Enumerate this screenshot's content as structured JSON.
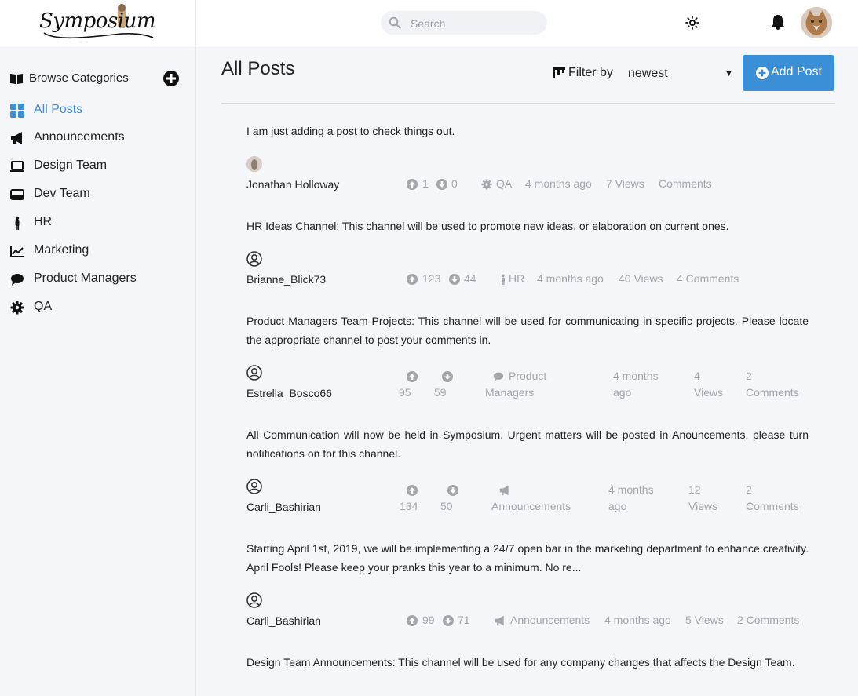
{
  "app": {
    "logo_text": "Symposium"
  },
  "search": {
    "placeholder": "Search"
  },
  "sidebar": {
    "browse_label": "Browse Categories",
    "items": [
      {
        "label": "All Posts",
        "icon": "grid-icon",
        "active": true
      },
      {
        "label": "Announcements",
        "icon": "megaphone-icon"
      },
      {
        "label": "Design Team",
        "icon": "laptop-icon"
      },
      {
        "label": "Dev Team",
        "icon": "hard-drive-icon"
      },
      {
        "label": "HR",
        "icon": "person-icon"
      },
      {
        "label": "Marketing",
        "icon": "line-chart-icon"
      },
      {
        "label": "Product Managers",
        "icon": "comment-icon"
      },
      {
        "label": "QA",
        "icon": "gear-icon"
      }
    ]
  },
  "main": {
    "title": "All Posts",
    "filter_label": "Filter by",
    "filter_value": "newest",
    "add_post_label": "Add Post"
  },
  "colors": {
    "accent": "#3b8fd6",
    "meta_text": "#a3a6ab",
    "background": "#f5f6fa"
  },
  "posts": [
    {
      "text": "I am just adding a post to check things out.",
      "author": "Jonathan Holloway",
      "up": "1",
      "down": "0",
      "category": "QA",
      "category_icon": "gear-icon",
      "time": "4 months ago",
      "views": "7 Views",
      "comments": "Comments"
    },
    {
      "text": "HR Ideas Channel: This channel will be used to promote new ideas, or elaboration on current ones.",
      "author": "Brianne_Blick73",
      "up": "123",
      "down": "44",
      "category": "HR",
      "category_icon": "person-icon",
      "time": "4 months ago",
      "views": "40 Views",
      "comments": "4 Comments"
    },
    {
      "text": "Product Managers Team Projects: This channel will be used for communicating in specific projects. Please locate the appropriate channel to post your comments in.",
      "author": "Estrella_Bosco66",
      "up": "95",
      "down": "59",
      "category_l1": "Product",
      "category_l2": "Managers",
      "category_icon": "comment-icon",
      "time_l1": "4 months",
      "time_l2": "ago",
      "views_l1": "4",
      "views_l2": "Views",
      "comments_l1": "2",
      "comments_l2": "Comments"
    },
    {
      "text": "All Communication will now be held in Symposium. Urgent matters will be posted in Anouncements, please turn notifications on for this channel.",
      "author": "Carli_Bashirian",
      "up": "134",
      "down": "50",
      "category": "Announcements",
      "category_icon": "megaphone-icon",
      "time_l1": "4 months",
      "time_l2": "ago",
      "views_l1": "12",
      "views_l2": "Views",
      "comments_l1": "2",
      "comments_l2": "Comments"
    },
    {
      "text": "Starting April 1st, 2019, we will be implementing a 24/7 open bar in the marketing department to enhance creativity. April Fools! Please keep your pranks this year to a minimum. No re...",
      "author": "Carli_Bashirian",
      "up": "99",
      "down": "71",
      "category": "Announcements",
      "category_icon": "megaphone-icon",
      "time": "4 months ago",
      "views": "5 Views",
      "comments": "2 Comments"
    },
    {
      "text": "Design Team Announcements: This channel will be used for any company changes that affects the Design Team."
    }
  ]
}
